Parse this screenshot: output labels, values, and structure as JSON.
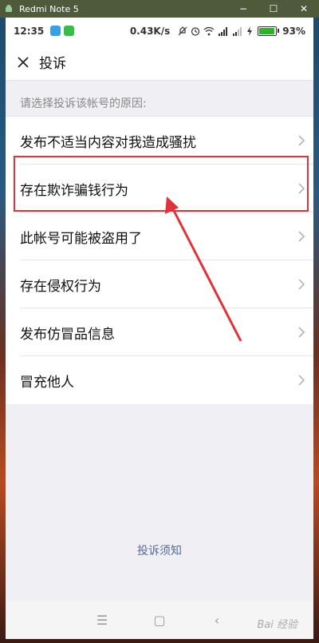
{
  "window": {
    "title": "Redmi Note 5",
    "minimize": "−",
    "maximize": "☐",
    "close": "✕"
  },
  "statusbar": {
    "time": "12:35",
    "speed": "0.43K/s",
    "battery": "93%",
    "battery_level": 0.93
  },
  "header": {
    "title": "投诉"
  },
  "section_label": "请选择投诉该帐号的原因:",
  "reasons": [
    {
      "label": "发布不适当内容对我造成骚扰"
    },
    {
      "label": "存在欺诈骗钱行为"
    },
    {
      "label": "此帐号可能被盗用了"
    },
    {
      "label": "存在侵权行为"
    },
    {
      "label": "发布仿冒品信息"
    },
    {
      "label": "冒充他人"
    }
  ],
  "footer_link": "投诉须知",
  "navbar": {
    "menu": "☰",
    "home": "▢",
    "back": "‹"
  },
  "watermark": "Bai 经验",
  "colors": {
    "accent_link": "#576b95",
    "highlight": "#e0323a"
  }
}
